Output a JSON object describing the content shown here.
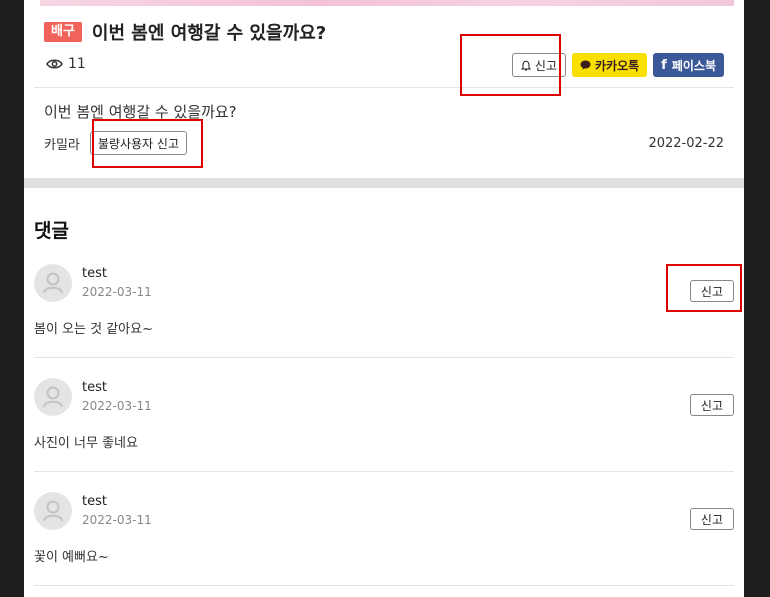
{
  "post": {
    "category": "배구",
    "title": "이번 봄엔 여행갈 수 있을까요?",
    "views": "11",
    "report_label": "신고",
    "kakao_label": "카카오톡",
    "facebook_label": "페이스북",
    "body": "이번 봄엔 여행갈 수 있을까요?",
    "author": "카밀라",
    "bad_user_report_label": "불량사용자 신고",
    "date": "2022-02-22"
  },
  "comments": {
    "title": "댓글",
    "items": [
      {
        "user": "test",
        "date": "2022-03-11",
        "text": "봄이 오는 것 같아요~",
        "report_label": "신고"
      },
      {
        "user": "test",
        "date": "2022-03-11",
        "text": "사진이 너무 좋네요",
        "report_label": "신고"
      },
      {
        "user": "test",
        "date": "2022-03-11",
        "text": "꽃이 예뻐요~",
        "report_label": "신고"
      }
    ]
  },
  "colors": {
    "category_badge": "#f0625a",
    "kakao": "#f9e000",
    "facebook": "#3b5998",
    "highlight": "#e00000"
  },
  "icons": [
    "eye-icon",
    "bell-icon",
    "kakao-icon",
    "facebook-icon",
    "user-avatar-icon"
  ]
}
